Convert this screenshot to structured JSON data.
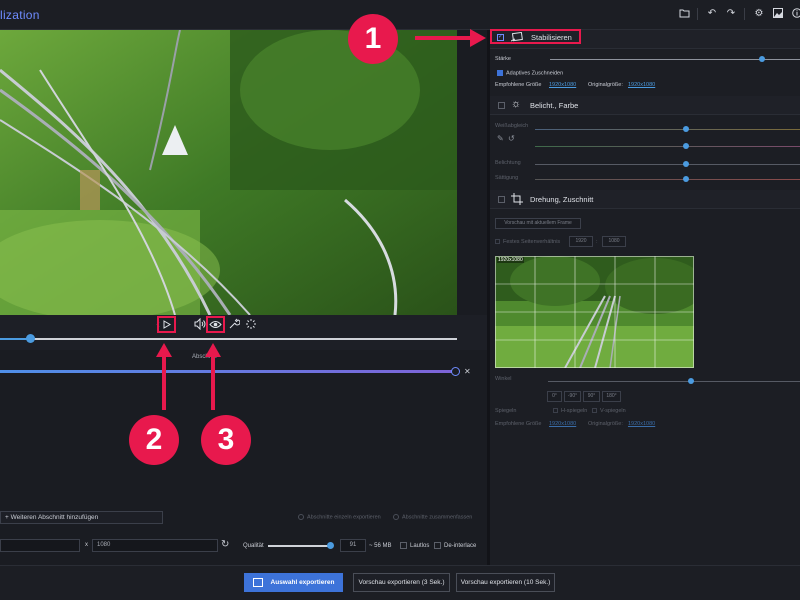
{
  "app": {
    "title": "lization"
  },
  "toolbar": {
    "icons": [
      "folder-icon",
      "undo-icon",
      "redo-icon",
      "gear-icon",
      "image-icon",
      "info-icon"
    ]
  },
  "player": {
    "controls": [
      "prev-frame-icon",
      "play-icon",
      "volume-icon",
      "eye-icon",
      "wrench-icon",
      "loading-icon"
    ]
  },
  "timeline": {
    "progress_fraction": 0.07
  },
  "sections_panel": {
    "abschnitt_label": "Abschnitt",
    "add_section_label": "+ Weiteren Abschnitt hinzufügen",
    "export_individually": "Abschnitte einzeln exportieren",
    "export_merge": "Abschnitte zusammenfassen"
  },
  "output_settings": {
    "width_value": "",
    "x_sep": "x",
    "height_value": "1080",
    "quality_label": "Qualität",
    "quality_value": "91",
    "size_label": "~ 56 MB",
    "mute_label": "Lautlos",
    "deinterlace_label": "De-interlace"
  },
  "bottom": {
    "export_label": "Auswahl exportieren",
    "preview3_label": "Vorschau exportieren (3 Sek.)",
    "preview10_label": "Vorschau exportieren (10 Sek.)"
  },
  "stabilize": {
    "title": "Stabilisieren",
    "checked": true,
    "strength_label": "Stärke",
    "adaptive_crop_label": "Adaptives Zuschneiden",
    "recommended_size_label": "Empfohlene Größe",
    "recommended_size_value": "1920x1080",
    "original_size_label": "Originalgröße:",
    "original_size_value": "1920x1080",
    "strength_value": 0.87
  },
  "exposure": {
    "title": "Belicht., Farbe",
    "white_balance_label": "Weißabgleich",
    "exposure_label": "Belichtung",
    "saturation_label": "Sättigung"
  },
  "rotate_crop": {
    "title": "Drehung, Zuschnitt",
    "preview_frame_button": "Vorschau mit aktuellem Frame",
    "fixed_ratio_label": "Festes Seitenverhältnis",
    "ratio_w": "1920",
    "ratio_sep": ":",
    "ratio_h": "1080",
    "preview_size_label": "1920x1080",
    "angle_label": "Winkel",
    "angles": [
      "0°",
      "-90°",
      "90°",
      "180°"
    ],
    "mirror_label": "Spiegeln",
    "h_mirror": "H-spiegeln",
    "v_mirror": "V-spiegeln",
    "recommended_size_label": "Empfohlene Größe",
    "recommended_size_value": "1920x1080",
    "original_size_label": "Originalgröße:",
    "original_size_value": "1920x1080"
  },
  "annotations": {
    "one": "1",
    "two": "2",
    "three": "3"
  },
  "colors": {
    "accent": "#3d73d9",
    "highlight": "#e8194d",
    "link": "#4b9be0"
  }
}
